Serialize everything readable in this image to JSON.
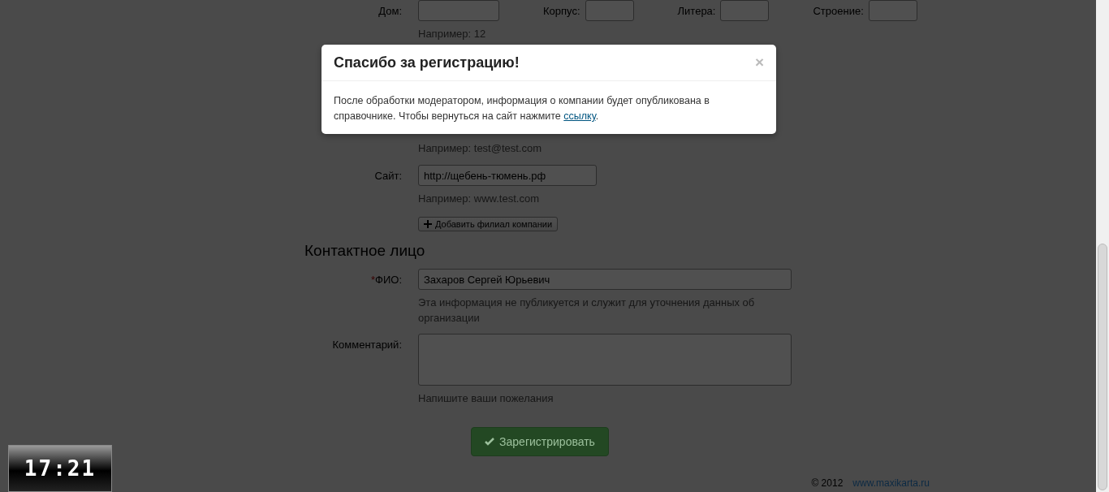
{
  "address_row": {
    "label": "Дом:",
    "parts": [
      {
        "label": "Корпус:"
      },
      {
        "label": "Литера:"
      },
      {
        "label": "Строение:"
      }
    ],
    "hint": "Например: 12"
  },
  "email_hint": "Например: test@test.com",
  "site": {
    "label": "Сайт:",
    "value": "http://щебень-тюмень.рф",
    "hint": "Например: www.test.com"
  },
  "add_branch_button": "Добавить филиал компании",
  "contact_heading": "Контактное лицо",
  "contact_fields": [
    {
      "kind": "input",
      "label": "ФИО:",
      "required_mark": "*",
      "value": "Захаров Сергей Юрьевич",
      "hint": "Эта информация не публикуется и служит для уточнения данных об организации"
    },
    {
      "kind": "textarea",
      "label": "Комментарий:",
      "hint": "Напишите ваши пожелания"
    }
  ],
  "submit_button": "Зарегистрировать",
  "footer": {
    "copyright": "© 2012",
    "link": "www.maxikarta.ru"
  },
  "modal": {
    "title": "Спасибо за регистрацию!",
    "close": "×",
    "text": "После обработки модератором, информация о компании будет опубликована в справочнике. Чтобы вернуться на сайт нажмите",
    "link": "ссылку",
    "after_link": "."
  },
  "clock": {
    "time": "17:21"
  }
}
